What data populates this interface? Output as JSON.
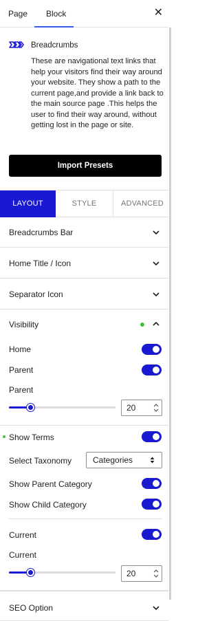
{
  "header": {
    "tabs": [
      {
        "label": "Page"
      },
      {
        "label": "Block"
      }
    ],
    "active_tab": "Block"
  },
  "block": {
    "name": "Breadcrumbs",
    "description": "These are navigational text links that help your visitors find their way around your website. They show a path to the current page,and provide a link back to the main source page .This helps the user to find their way around, without getting lost in the page or site.",
    "import_button": "Import Presets"
  },
  "settings_tabs": {
    "items": [
      {
        "label": "LAYOUT"
      },
      {
        "label": "STYLE"
      },
      {
        "label": "ADVANCED"
      }
    ],
    "active": "LAYOUT"
  },
  "panels": {
    "breadcrumbs_bar": "Breadcrumbs Bar",
    "home_title": "Home Title / Icon",
    "separator": "Separator Icon",
    "visibility": "Visibility",
    "seo": "SEO Option"
  },
  "visibility": {
    "home": {
      "label": "Home",
      "on": true
    },
    "parent": {
      "label": "Parent",
      "on": true
    },
    "parent_slider": {
      "label": "Parent",
      "value": "20",
      "fraction": 0.2
    },
    "show_terms": {
      "label": "Show Terms",
      "on": true
    },
    "taxonomy": {
      "label": "Select Taxonomy",
      "value": "Categories"
    },
    "show_parent_category": {
      "label": "Show Parent Category",
      "on": true
    },
    "show_child_category": {
      "label": "Show Child Category",
      "on": true
    },
    "current": {
      "label": "Current",
      "on": true
    },
    "current_slider": {
      "label": "Current",
      "value": "20",
      "fraction": 0.2
    }
  },
  "colors": {
    "accent": "#1919d1",
    "indicator_dot": "#3ec23e",
    "tab_underline": "#3858e9"
  },
  "icons": {
    "close": "close-icon",
    "block": "breadcrumbs-icon",
    "chevron_down": "chevron-down-icon",
    "chevron_up": "chevron-up-icon"
  }
}
